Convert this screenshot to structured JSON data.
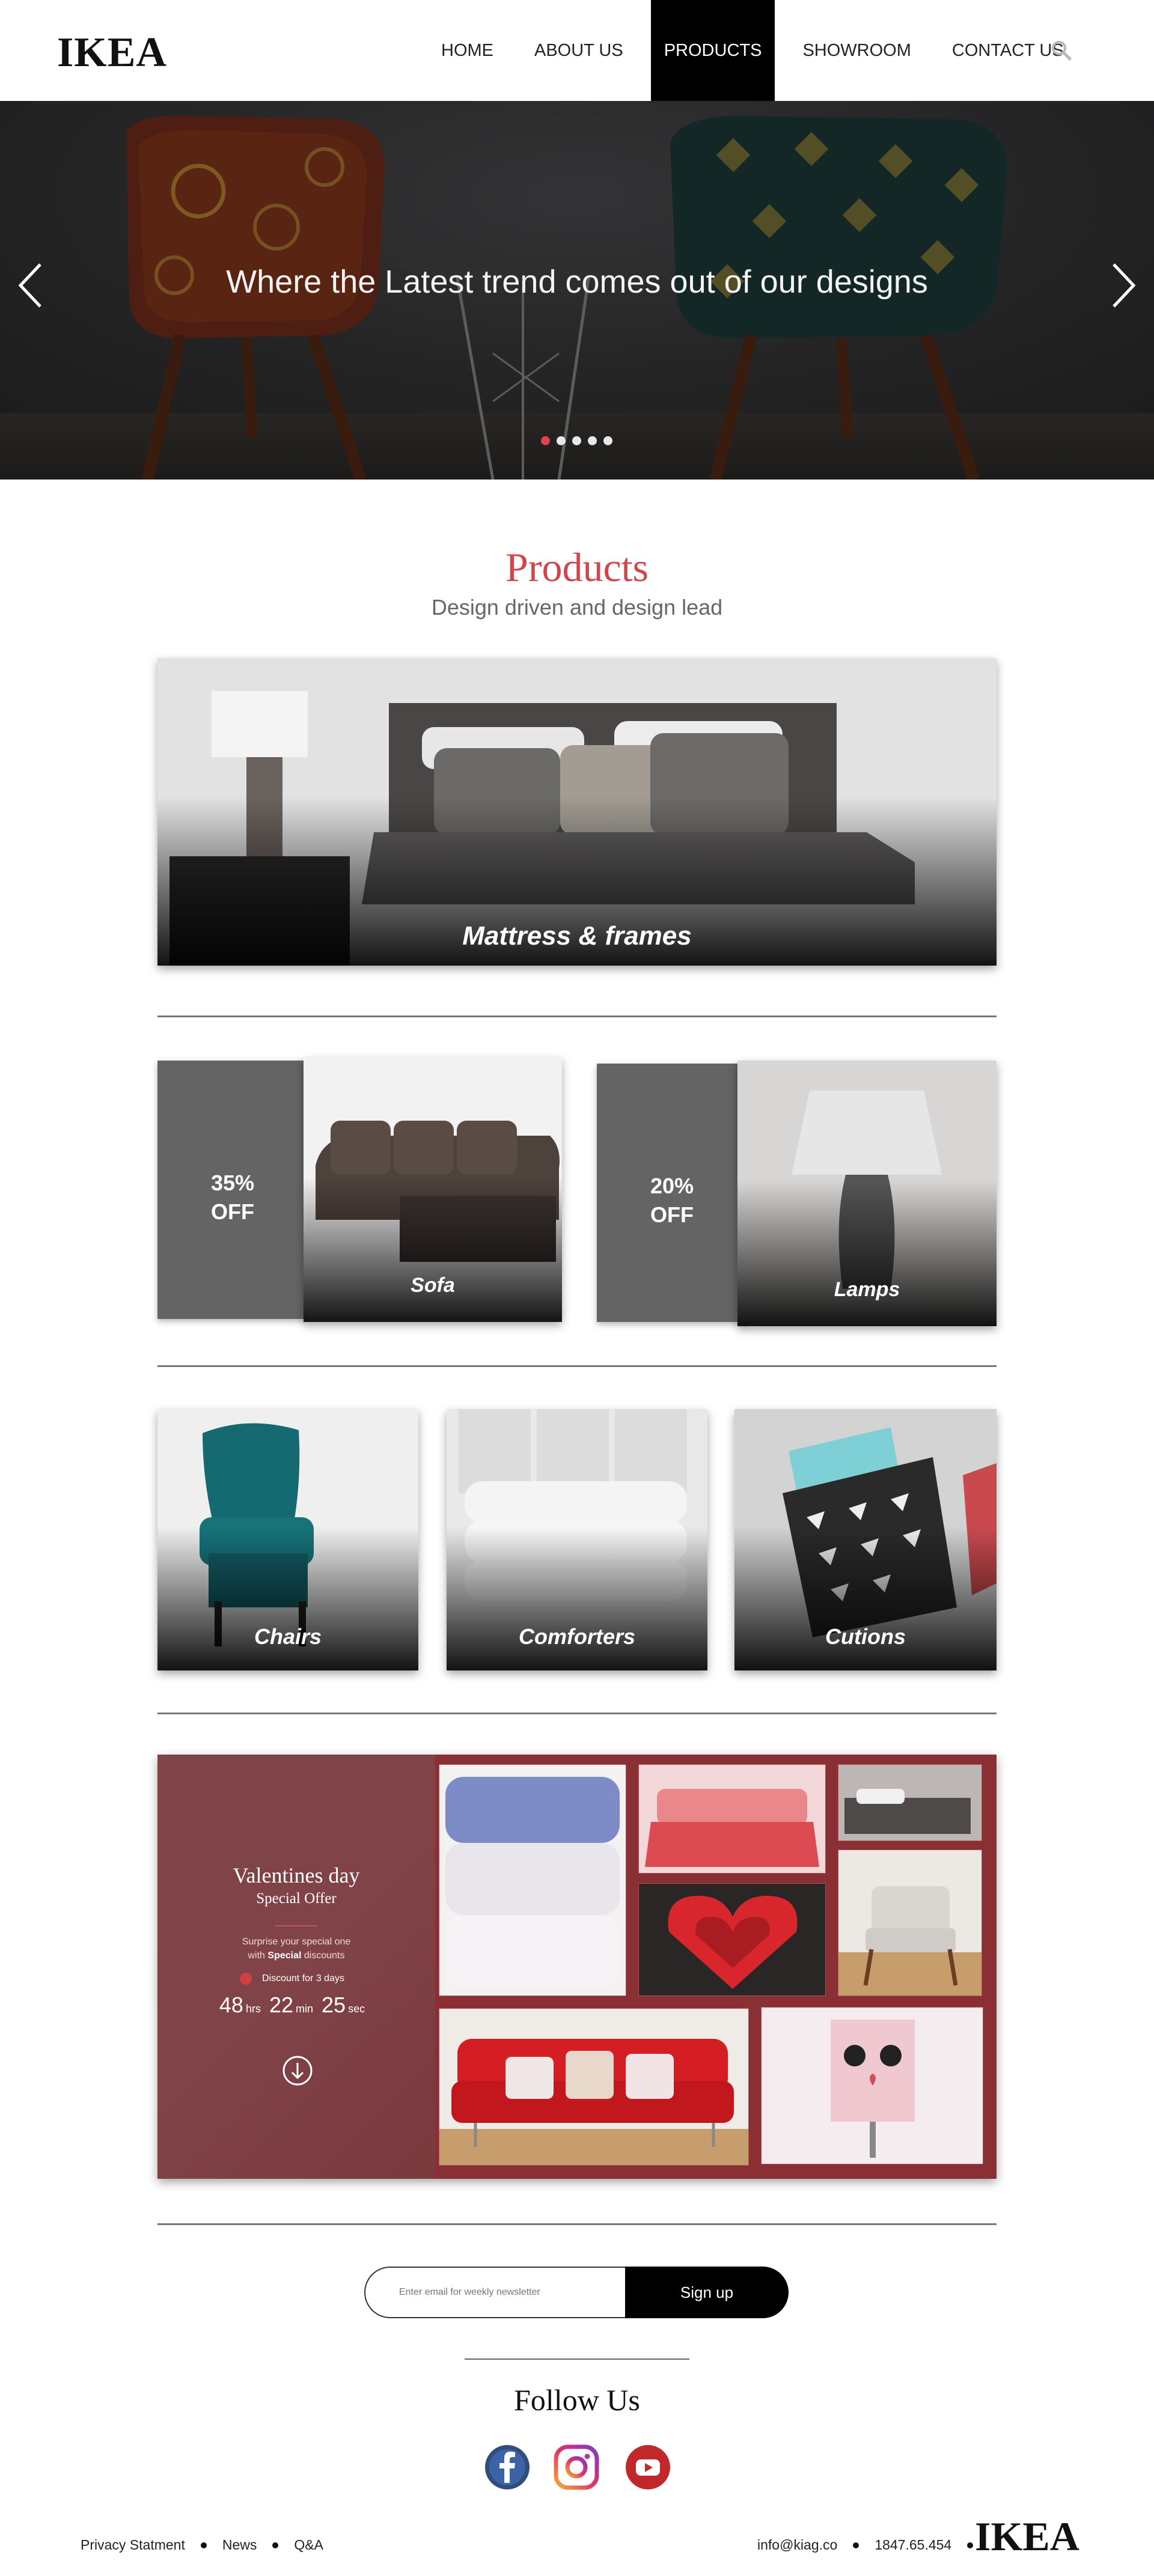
{
  "header": {
    "logo": "IKEA",
    "nav": [
      {
        "label": "HOME",
        "active": false
      },
      {
        "label": "ABOUT US",
        "active": false
      },
      {
        "label": "PRODUCTS",
        "active": true
      },
      {
        "label": "SHOWROOM",
        "active": false
      },
      {
        "label": "CONTACT US",
        "active": false
      }
    ]
  },
  "hero": {
    "title": "Where the Latest trend comes out of our designs",
    "slide_count": 5,
    "active_slide": 1
  },
  "products": {
    "title": "Products",
    "subtitle": "Design driven and design lead",
    "featured": {
      "label": "Mattress & frames"
    },
    "deals": [
      {
        "discount": "35%",
        "off": "OFF",
        "label": "Sofa"
      },
      {
        "discount": "20%",
        "off": "OFF",
        "label": "Lamps"
      }
    ],
    "categories": [
      {
        "label": "Chairs"
      },
      {
        "label": "Comforters"
      },
      {
        "label": "Cutions"
      }
    ]
  },
  "valentine": {
    "title": "Valentines day",
    "subtitle": "Special Offer",
    "text_line1": "Surprise your special one",
    "text_line2_prefix": "with ",
    "text_line2_bold": "Special",
    "text_line2_suffix": " discounts",
    "discount_note": "Discount for 3 days",
    "countdown": {
      "hrs": "48",
      "hrs_unit": "hrs",
      "min": "22",
      "min_unit": "min",
      "sec": "25",
      "sec_unit": "sec"
    }
  },
  "newsletter": {
    "placeholder": "Enter email for weekly newsletter",
    "button": "Sign up"
  },
  "follow": {
    "title": "Follow Us",
    "networks": [
      "facebook-icon",
      "instagram-icon",
      "youtube-icon"
    ]
  },
  "footer": {
    "links": [
      "Privacy Statment",
      "News",
      "Q&A"
    ],
    "email": "info@kiag.co",
    "phone": "1847.65.454",
    "logo": "IKEA"
  },
  "colors": {
    "accent": "#d1454b",
    "valentine_bg": "#8a3035",
    "offer_box": "#646464",
    "dark": "#000000"
  }
}
